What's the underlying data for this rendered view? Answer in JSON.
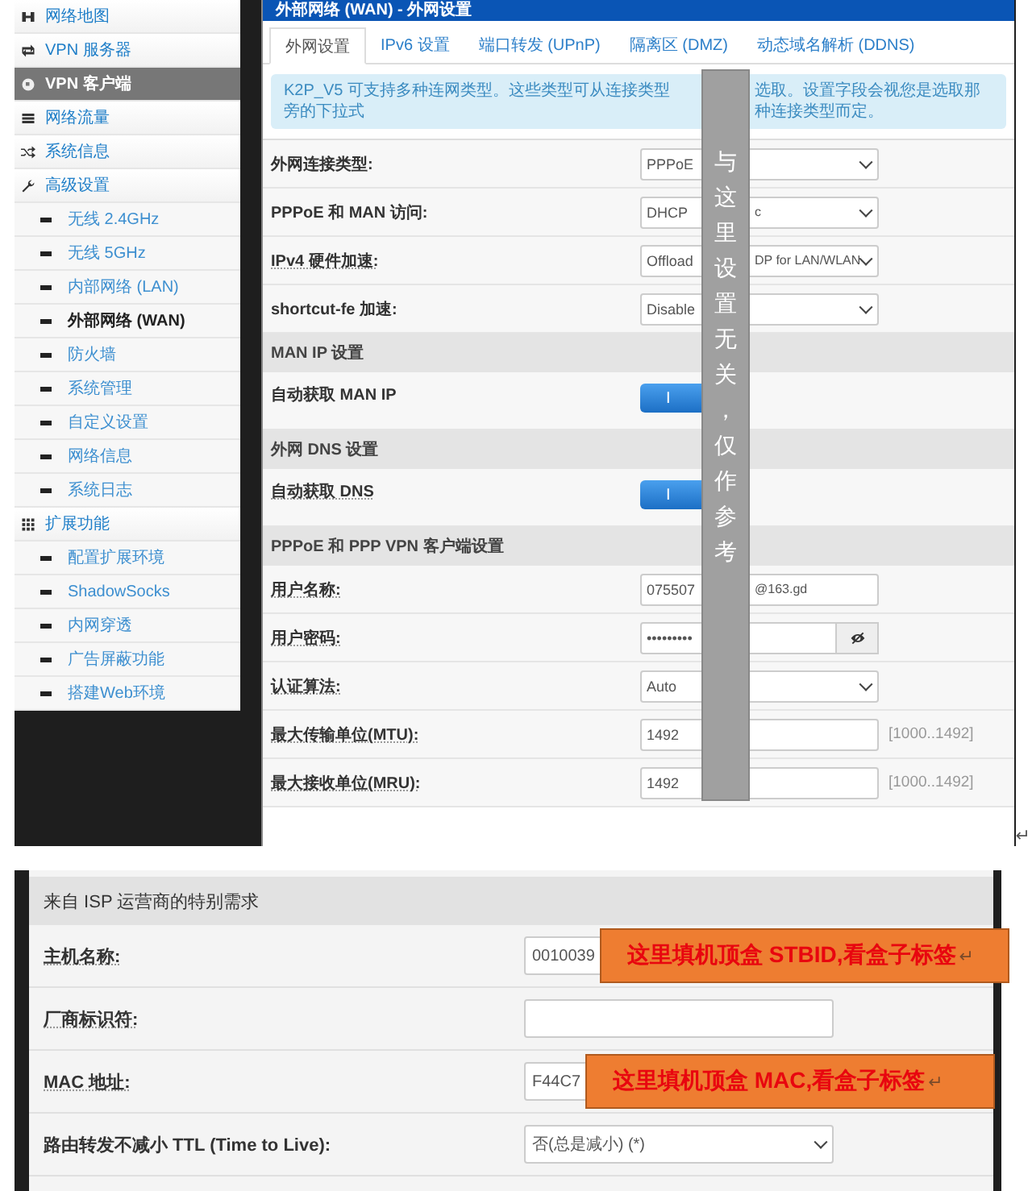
{
  "sidebar": {
    "items": [
      {
        "label": "网络地图",
        "kind": "group",
        "selected": false,
        "highlighted": false
      },
      {
        "label": "VPN 服务器",
        "kind": "group",
        "selected": false,
        "highlighted": false
      },
      {
        "label": "VPN 客户端",
        "kind": "group",
        "selected": false,
        "highlighted": true
      },
      {
        "label": "网络流量",
        "kind": "group",
        "selected": false,
        "highlighted": false
      },
      {
        "label": "系统信息",
        "kind": "group",
        "selected": false,
        "highlighted": false
      },
      {
        "label": "高级设置",
        "kind": "group",
        "selected": false,
        "highlighted": false
      },
      {
        "label": "无线 2.4GHz",
        "kind": "sub",
        "selected": false,
        "highlighted": false
      },
      {
        "label": "无线 5GHz",
        "kind": "sub",
        "selected": false,
        "highlighted": false
      },
      {
        "label": "内部网络 (LAN)",
        "kind": "sub",
        "selected": false,
        "highlighted": false
      },
      {
        "label": "外部网络 (WAN)",
        "kind": "sub",
        "selected": true,
        "highlighted": false
      },
      {
        "label": "防火墙",
        "kind": "sub",
        "selected": false,
        "highlighted": false
      },
      {
        "label": "系统管理",
        "kind": "sub",
        "selected": false,
        "highlighted": false
      },
      {
        "label": "自定义设置",
        "kind": "sub",
        "selected": false,
        "highlighted": false
      },
      {
        "label": "网络信息",
        "kind": "sub",
        "selected": false,
        "highlighted": false
      },
      {
        "label": "系统日志",
        "kind": "sub",
        "selected": false,
        "highlighted": false
      },
      {
        "label": "扩展功能",
        "kind": "group",
        "selected": false,
        "highlighted": false
      },
      {
        "label": "配置扩展环境",
        "kind": "sub",
        "selected": false,
        "highlighted": false
      },
      {
        "label": "ShadowSocks",
        "kind": "sub",
        "selected": false,
        "highlighted": false
      },
      {
        "label": "内网穿透",
        "kind": "sub",
        "selected": false,
        "highlighted": false
      },
      {
        "label": "广告屏蔽功能",
        "kind": "sub",
        "selected": false,
        "highlighted": false
      },
      {
        "label": "搭建Web环境",
        "kind": "sub",
        "selected": false,
        "highlighted": false
      }
    ]
  },
  "panel": {
    "title": "外部网络 (WAN) - 外网设置",
    "tabs": [
      {
        "label": "外网设置",
        "selected": true
      },
      {
        "label": "IPv6 设置",
        "selected": false
      },
      {
        "label": "端口转发 (UPnP)",
        "selected": false
      },
      {
        "label": "隔离区 (DMZ)",
        "selected": false
      },
      {
        "label": "动态域名解析 (DDNS)",
        "selected": false
      }
    ],
    "info": "K2P_V5 可支持多种连网类型。这些类型可从连接类型旁的下拉式",
    "info_after": "选取。设置字段会视您是选取那种连接类型而定。",
    "rows": [
      {
        "kind": "select",
        "label": "外网连接类型:",
        "tooltip": false,
        "value": "PPPoE"
      },
      {
        "kind": "select",
        "label": "PPPoE 和 MAN 访问:",
        "tooltip": false,
        "value": "DHCP",
        "value_after": "c"
      },
      {
        "kind": "select",
        "label": "IPv4 硬件加速:",
        "tooltip": true,
        "value": "Offload",
        "value_after": "DP for LAN/WLAN"
      },
      {
        "kind": "select",
        "label": "shortcut-fe 加速:",
        "tooltip": false,
        "value": "Disable"
      },
      {
        "kind": "section",
        "label": "MAN IP 设置"
      },
      {
        "kind": "toggle",
        "label": "自动获取 MAN IP",
        "tooltip": false,
        "on": true,
        "on_label": "I"
      },
      {
        "kind": "section",
        "label": "外网 DNS 设置"
      },
      {
        "kind": "toggle",
        "label": "自动获取 DNS",
        "tooltip": true,
        "on": true,
        "on_label": "I"
      },
      {
        "kind": "section",
        "label": "PPPoE 和 PPP VPN 客户端设置"
      },
      {
        "kind": "input",
        "label": "用户名称:",
        "tooltip": true,
        "value": "075507",
        "value_after": "@163.gd"
      },
      {
        "kind": "password",
        "label": "用户密码:",
        "tooltip": true,
        "value": "•••••••••"
      },
      {
        "kind": "select",
        "label": "认证算法:",
        "tooltip": true,
        "value": "Auto"
      },
      {
        "kind": "input",
        "label": "最大传输单位(MTU):",
        "tooltip": true,
        "value": "1492",
        "hint": "[1000..1492]"
      },
      {
        "kind": "input",
        "label": "最大接收单位(MRU):",
        "tooltip": true,
        "value": "1492",
        "hint": "[1000..1492]"
      }
    ],
    "note": "与这里设置无关，仅作参考"
  },
  "return_mark": "↵",
  "isp": {
    "title": "来自 ISP 运营商的特别需求",
    "rows": [
      {
        "kind": "input",
        "label": "主机名称:",
        "value": "0010039",
        "callout": "这里填机顶盒 STBID,看盒子标签"
      },
      {
        "kind": "input",
        "label": "厂商标识符:"
      },
      {
        "kind": "input",
        "label": "MAC 地址:",
        "value": "F44C7",
        "callout": "这里填机顶盒 MAC,看盒子标签"
      },
      {
        "kind": "select",
        "label": "路由转发不减小 TTL (Time to Live):",
        "value": "否(总是减小) (*)"
      }
    ]
  }
}
